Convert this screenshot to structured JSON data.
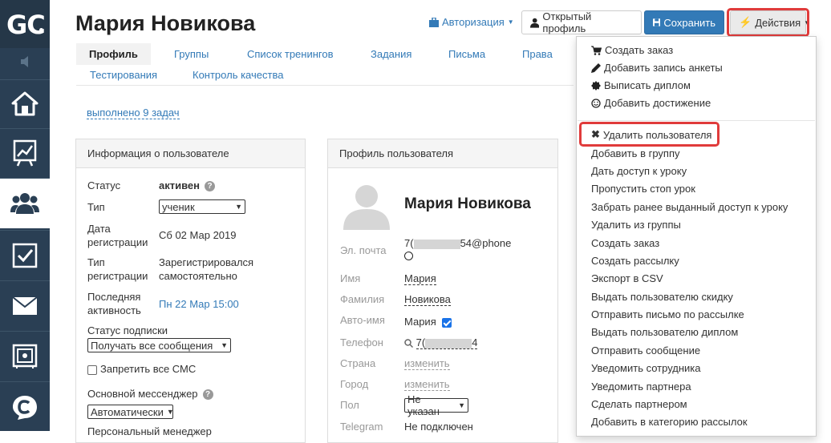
{
  "sidebar": {
    "logo_text": "GC",
    "items": [
      {
        "icon": "home-icon"
      },
      {
        "icon": "chart-board-icon"
      },
      {
        "icon": "users-icon",
        "active": true
      },
      {
        "icon": "checkbox-icon"
      },
      {
        "icon": "mail-icon"
      },
      {
        "icon": "safe-icon"
      },
      {
        "icon": "chat-c-icon"
      }
    ]
  },
  "header": {
    "title": "Мария Новикова",
    "auth_link": "Авторизация",
    "open_profile_label": "Открытый профиль",
    "save_label": "Сохранить",
    "actions_label": "Действия"
  },
  "tabs": [
    {
      "label": "Профиль",
      "active": true
    },
    {
      "label": "Группы"
    },
    {
      "label": "Список тренингов"
    },
    {
      "label": "Задания"
    },
    {
      "label": "Письма"
    },
    {
      "label": "Права"
    },
    {
      "label": "Тестирования"
    },
    {
      "label": "Контроль качества"
    }
  ],
  "tasks_link": "выполнено 9 задач",
  "info_panel": {
    "title": "Информация о пользователе",
    "status_label": "Статус",
    "status_value": "активен",
    "type_label": "Тип",
    "type_value": "ученик",
    "reg_date_label": "Дата регистрации",
    "reg_date_value": "Сб 02 Мар 2019",
    "reg_type_label": "Тип регистрации",
    "reg_type_value": "Зарегистрировался самостоятельно",
    "last_active_label": "Последняя активность",
    "last_active_value": "Пн 22 Мар 15:00",
    "subscription_label": "Статус подписки",
    "subscription_value": "Получать все сообщения",
    "sms_label": "Запретить все СМС",
    "messenger_label": "Основной мессенджер",
    "messenger_value": "Автоматически",
    "cut_label": "Персональный менеджер"
  },
  "profile_panel": {
    "title": "Профиль пользователя",
    "name": "Мария Новикова",
    "email_label": "Эл. почта",
    "email_prefix": "7(",
    "email_suffix": "54@phone",
    "first_name_label": "Имя",
    "first_name_value": "Мария",
    "last_name_label": "Фамилия",
    "last_name_value": "Новикова",
    "autoname_label": "Авто-имя",
    "autoname_value": "Мария",
    "phone_label": "Телефон",
    "phone_prefix": "7(",
    "phone_suffix": "4",
    "country_label": "Страна",
    "country_value": "изменить",
    "city_label": "Город",
    "city_value": "изменить",
    "gender_label": "Пол",
    "gender_value": "Не указан",
    "telegram_label": "Telegram",
    "telegram_value": "Не подключен"
  },
  "actions_menu": {
    "top_items": [
      {
        "label": "Создать заказ",
        "icon": "cart-icon"
      },
      {
        "label": "Добавить запись анкеты",
        "icon": "pencil-icon"
      },
      {
        "label": "Выписать диплом",
        "icon": "certificate-icon"
      },
      {
        "label": "Добавить достижение",
        "icon": "smile-icon"
      }
    ],
    "delete_user": "Удалить пользователя",
    "items": [
      "Добавить в группу",
      "Дать доступ к уроку",
      "Пропустить стоп урок",
      "Забрать ранее выданный доступ к уроку",
      "Удалить из группы",
      "Создать заказ",
      "Создать рассылку",
      "Экспорт в CSV",
      "Выдать пользователю скидку",
      "Отправить письмо по рассылке",
      "Выдать пользователю диплом",
      "Отправить сообщение",
      "Уведомить сотрудника",
      "Уведомить партнера",
      "Сделать партнером",
      "Добавить в категорию рассылок"
    ]
  }
}
